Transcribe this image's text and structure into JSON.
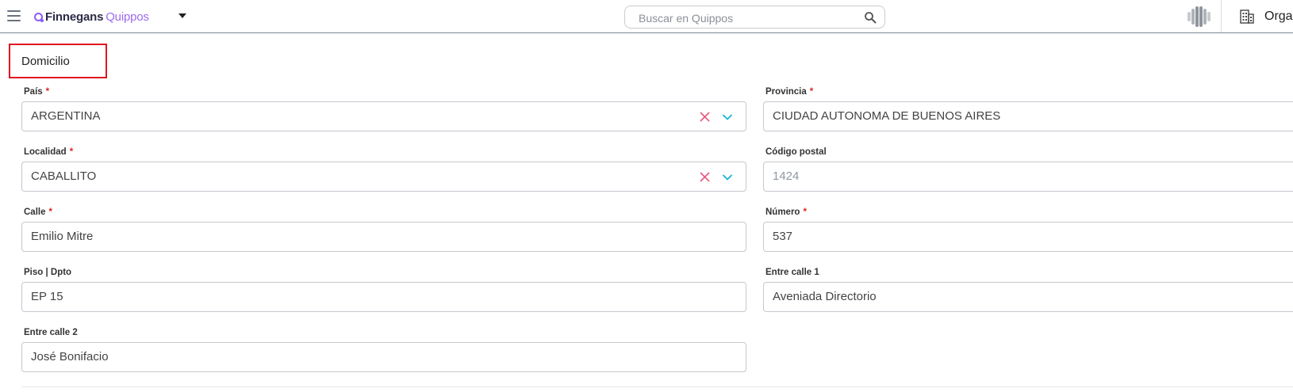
{
  "header": {
    "brand_primary": "Finnegans",
    "brand_secondary": "Quippos",
    "search_placeholder": "Buscar en Quippos",
    "org_label": "Organización"
  },
  "section": {
    "title": "Domicilio"
  },
  "fields": {
    "pais": {
      "label": "País",
      "required": "*",
      "value": "ARGENTINA"
    },
    "provincia": {
      "label": "Provincia",
      "required": "*",
      "value": "CIUDAD AUTONOMA DE BUENOS AIRES"
    },
    "localidad": {
      "label": "Localidad",
      "required": "*",
      "value": "CABALLITO"
    },
    "codigo_postal": {
      "label": "Código postal",
      "value": "1424"
    },
    "calle": {
      "label": "Calle",
      "required": "*",
      "value": "Emilio Mitre"
    },
    "numero": {
      "label": "Número",
      "required": "*",
      "value": "537"
    },
    "piso_dpto": {
      "label": "Piso | Dpto",
      "value": "EP 15"
    },
    "entre_calle_1": {
      "label": "Entre calle 1",
      "value": "Aveniada Directorio"
    },
    "entre_calle_2": {
      "label": "Entre calle 2",
      "value": "José Bonifacio"
    }
  },
  "colors": {
    "brand_purple": "#8b5cf6",
    "required_red": "#e02424",
    "clear_icon_pink": "#e8547a",
    "chevron_cyan": "#17b3d9",
    "highlight_red": "#e0161e"
  }
}
